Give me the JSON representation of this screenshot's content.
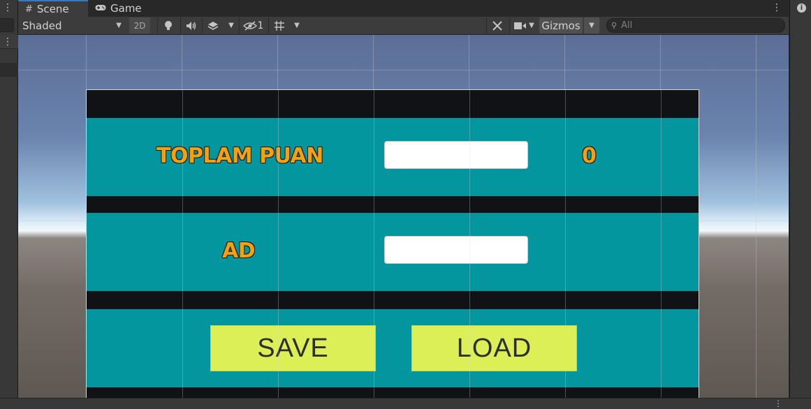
{
  "tabs": [
    {
      "label": "Scene",
      "icon": "grid-icon",
      "active": true
    },
    {
      "label": "Game",
      "icon": "gamepad-icon",
      "active": false
    }
  ],
  "toolbar": {
    "shading_mode": "Shaded",
    "toggle_2d": "2D",
    "hidden_count": "1",
    "gizmos_label": "Gizmos",
    "search_placeholder": "All"
  },
  "game_ui": {
    "score_label": "TOPLAM PUAN",
    "score_value": "0",
    "name_label": "AD",
    "save_button": "SAVE",
    "load_button": "LOAD"
  },
  "colors": {
    "panel": "#03969f",
    "label_text": "#f3a10c",
    "button_bg": "#dcef57",
    "tab_accent": "#3a79bb"
  }
}
